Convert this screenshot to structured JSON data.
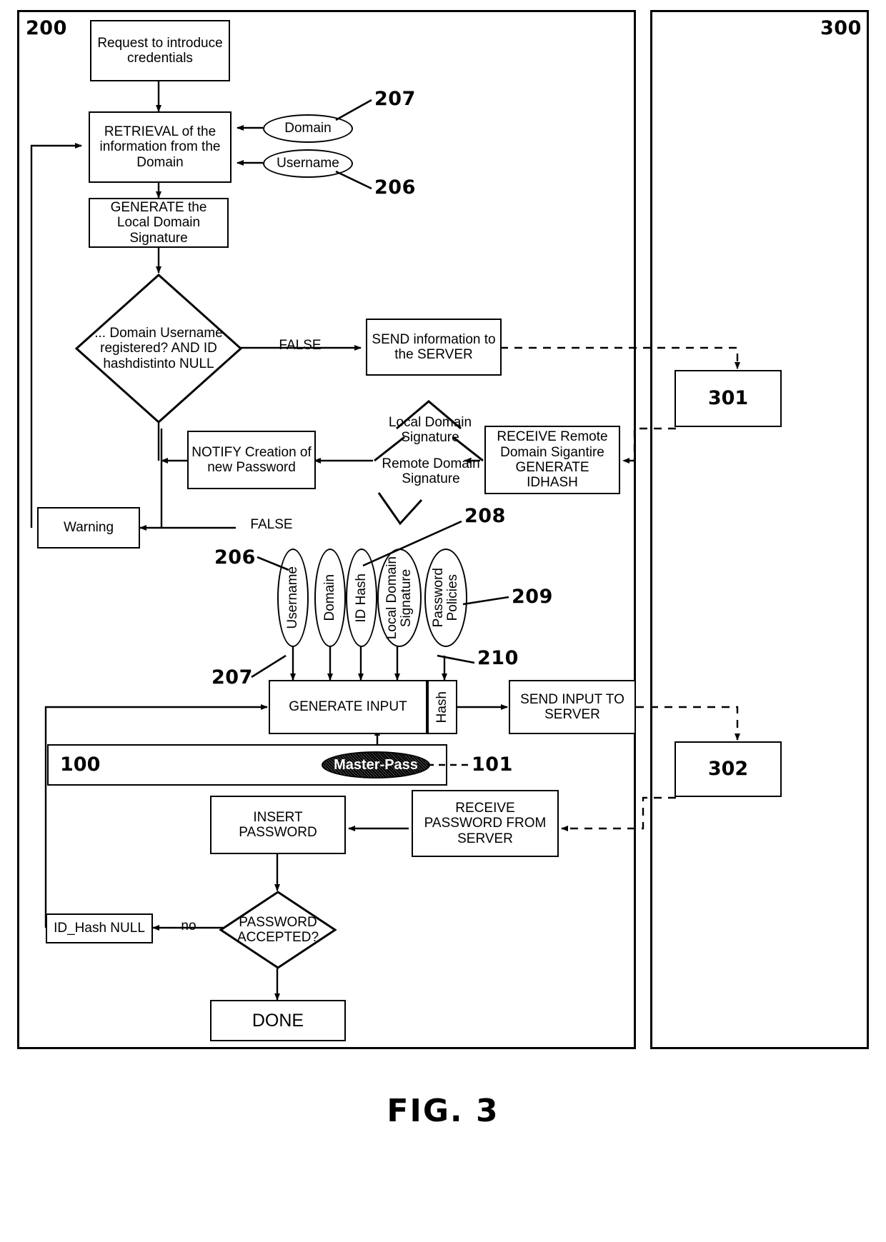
{
  "figure": {
    "caption": "FIG. 3"
  },
  "panels": [
    {
      "id": "client",
      "label": "200"
    },
    {
      "id": "server",
      "label": "300"
    }
  ],
  "nodes": {
    "request": "Request to introduce credentials",
    "retrieval": "RETRIEVAL of the information from the Domain",
    "generate_signature": "GENERATE the Local Domain Signature",
    "decision_registered": "... Domain Username registered? AND ID hashdistinto NULL",
    "send_info_server": "SEND information to the SERVER",
    "notify_creation": "NOTIFY Creation of new Password",
    "receive_remote": "RECEIVE Remote Domain Sigantire GENERATE IDHASH",
    "warning": "Warning",
    "generate_input": "GENERATE INPUT",
    "hash_cell": "Hash",
    "send_input_server": "SEND INPUT TO SERVER",
    "master_pass": "Master-Pass",
    "insert_password": "INSERT PASSWORD",
    "receive_password": "RECEIVE PASSWORD FROM SERVER",
    "id_hash_null": "ID_Hash NULL",
    "decision_accepted": "PASSWORD ACCEPTED?",
    "done": "DONE",
    "server_301": "301",
    "server_302": "302",
    "device_100": "100"
  },
  "input_ovals_top": [
    {
      "id": "domain",
      "label": "Domain"
    },
    {
      "id": "username",
      "label": "Username"
    }
  ],
  "input_ovals_stack": [
    {
      "id": "username",
      "label": "Username"
    },
    {
      "id": "domain",
      "label": "Domain"
    },
    {
      "id": "id-hash",
      "label": "ID Hash"
    },
    {
      "id": "local-domain-signature",
      "label": "Local Domain\nSignature"
    },
    {
      "id": "password-policies",
      "label": "Password\nPolicies"
    }
  ],
  "edge_labels": {
    "false_1": "FALSE",
    "false_2": "FALSE",
    "no": "no",
    "local_domain_signature": "Local Domain Signature",
    "remote_domain_signature": "Remote Domain Signature"
  },
  "reference_numerals": {
    "n207_top": "207",
    "n206_top": "206",
    "n208": "208",
    "n206_stack": "206",
    "n209": "209",
    "n207_stack": "207",
    "n210": "210",
    "n101": "101"
  },
  "colors": {
    "ink": "#000000",
    "paper": "#ffffff"
  }
}
